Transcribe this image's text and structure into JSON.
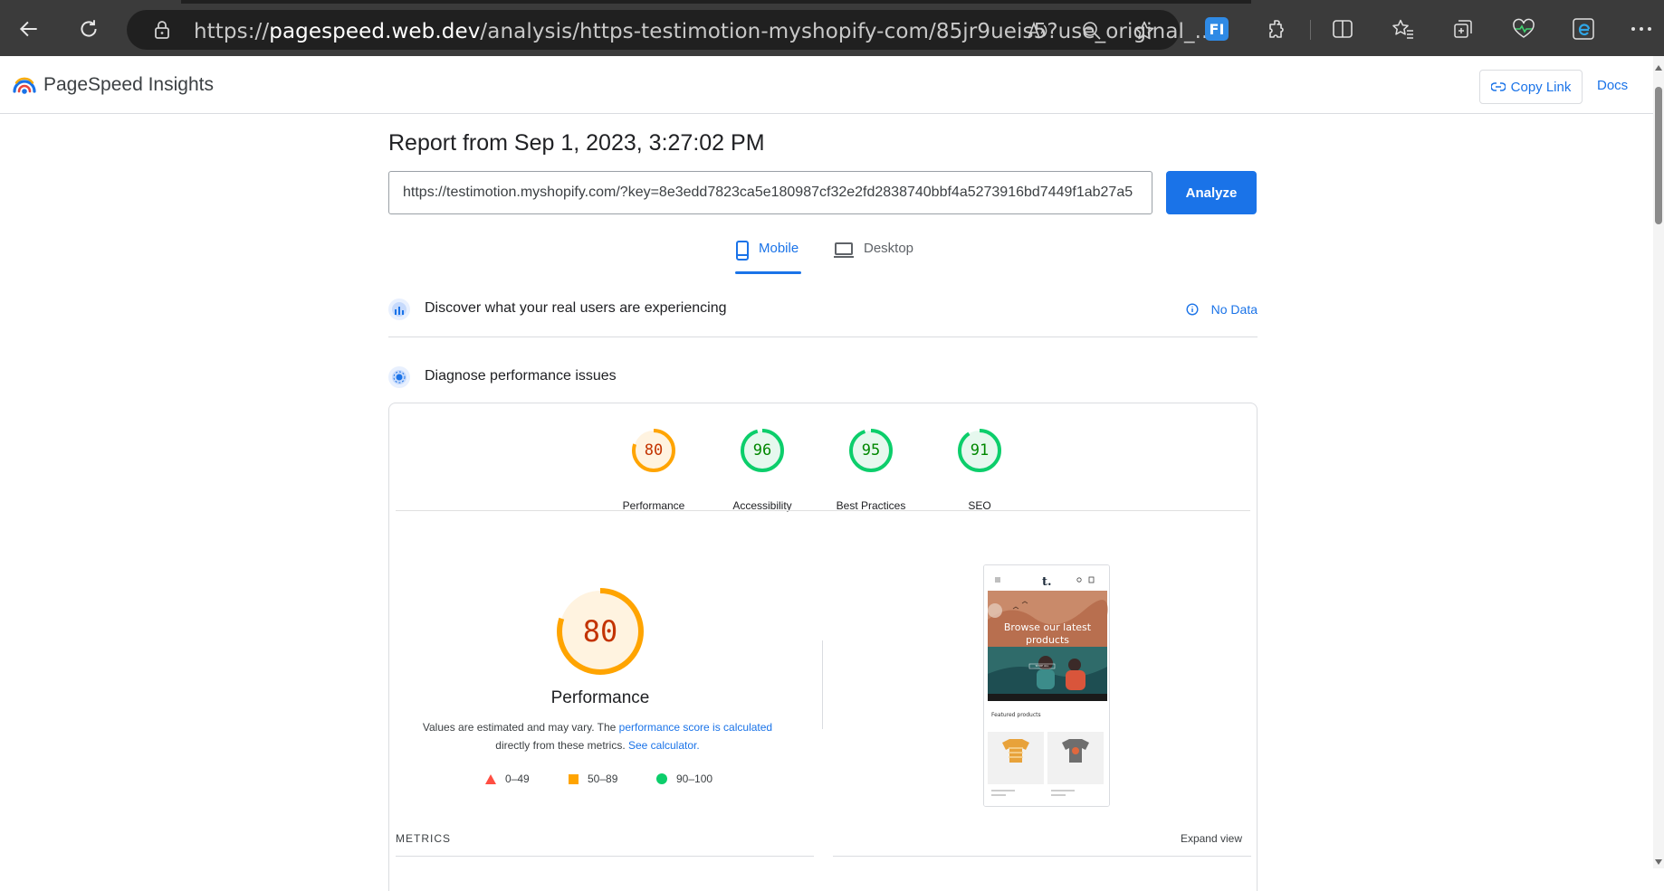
{
  "browser": {
    "url_prefix": "https://",
    "url_host": "pagespeed.web.dev",
    "url_path": "/analysis/https-testimotion-myshopify-com/85jr9ueis5?use_original_...",
    "icons": [
      "back-icon",
      "refresh-icon",
      "lock-icon",
      "read-aloud-icon",
      "zoom-out-icon",
      "favorite-star-icon",
      "extension-fi-icon",
      "extensions-icon",
      "split-screen-icon",
      "favorites-icon",
      "collections-icon",
      "performance-icon",
      "edge-icon",
      "more-icon"
    ],
    "fi_badge": "FI"
  },
  "header": {
    "brand": "PageSpeed Insights",
    "copy_link": "Copy Link",
    "docs": "Docs"
  },
  "report": {
    "title": "Report from Sep 1, 2023, 3:27:02 PM",
    "input_value": "https://testimotion.myshopify.com/?key=8e3edd7823ca5e180987cf32e2fd2838740bbf4a5273916bd7449f1ab27a5",
    "analyze": "Analyze",
    "tabs": [
      {
        "label": "Mobile",
        "active": true
      },
      {
        "label": "Desktop",
        "active": false
      }
    ]
  },
  "sections": {
    "real_users": {
      "title": "Discover what your real users are experiencing",
      "status": "No Data"
    },
    "diagnose": {
      "title": "Diagnose performance issues"
    }
  },
  "scores": [
    {
      "value": "80",
      "label": "Performance",
      "level": 0.8,
      "color": "#ffa400",
      "text_color": "#c33300",
      "fill": "#fff3e0"
    },
    {
      "value": "96",
      "label": "Accessibility",
      "level": 0.96,
      "color": "#0cce6b",
      "text_color": "#008800",
      "fill": "#e6f8ee"
    },
    {
      "value": "95",
      "label": "Best Practices",
      "level": 0.95,
      "color": "#0cce6b",
      "text_color": "#008800",
      "fill": "#e6f8ee"
    },
    {
      "value": "91",
      "label": "SEO",
      "level": 0.91,
      "color": "#0cce6b",
      "text_color": "#008800",
      "fill": "#e6f8ee"
    }
  ],
  "performance": {
    "score": "80",
    "title": "Performance",
    "explain_1": "Values are estimated and may vary. The ",
    "explain_link_1": "performance score is calculated",
    "explain_2": "directly from these metrics. ",
    "explain_link_2": "See calculator.",
    "legend": [
      {
        "range": "0–49",
        "color": "#ff4e42",
        "shape": "triangle"
      },
      {
        "range": "50–89",
        "color": "#ffa400",
        "shape": "square"
      },
      {
        "range": "90–100",
        "color": "#0cce6b",
        "shape": "circle"
      }
    ]
  },
  "screenshot": {
    "hero_text": "Browse our latest products",
    "featured": "Featured products",
    "shop_btn": "SHOP ALL"
  },
  "metrics": {
    "label": "METRICS",
    "expand": "Expand view"
  }
}
